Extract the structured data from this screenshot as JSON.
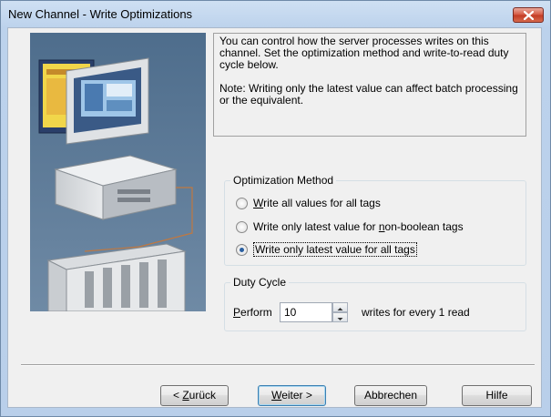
{
  "window": {
    "title": "New Channel - Write Optimizations"
  },
  "info": {
    "paragraph1": "You can control how the server processes writes on this channel.  Set the optimization method and write-to-read duty cycle below.",
    "paragraph2": "Note:  Writing only the latest value can affect batch processing or the equivalent."
  },
  "optimization": {
    "legend": "Optimization Method",
    "options": [
      {
        "prefix": "",
        "accel": "W",
        "rest": "rite all values for all tags",
        "checked": false
      },
      {
        "prefix": "Write only latest value for ",
        "accel": "n",
        "rest": "on-boolean tags",
        "checked": false
      },
      {
        "prefix": "Write only latest value for all tags",
        "accel": "",
        "rest": "",
        "checked": true
      }
    ]
  },
  "duty": {
    "legend": "Duty Cycle",
    "perform_accel": "P",
    "perform_rest": "erform",
    "value": "10",
    "suffix": "writes for every 1 read"
  },
  "buttons": {
    "back_prefix": "< ",
    "back_accel": "Z",
    "back_rest": "urück",
    "next_accel": "W",
    "next_rest": "eiter >",
    "cancel": "Abbrechen",
    "help": "Hilfe"
  },
  "colors": {
    "titlebar": "#bcd2ec",
    "close": "#c9472e",
    "dialog_bg": "#f0f0f0",
    "radio_dot": "#2a5fa0"
  }
}
